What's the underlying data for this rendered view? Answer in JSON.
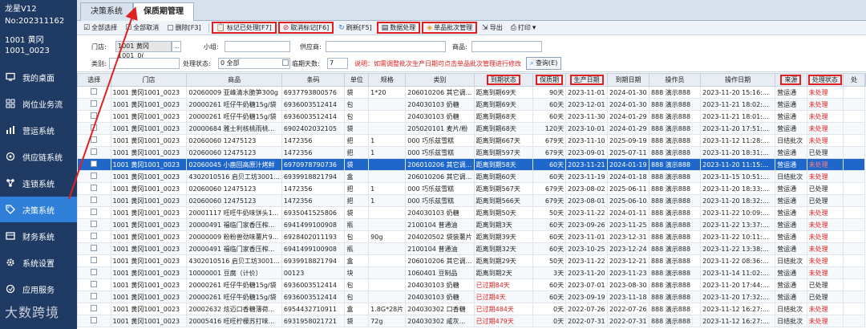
{
  "app": {
    "name": "龙星V12",
    "serial": "No:202311162",
    "store_line1": "1001 黄冈",
    "store_line2": "1001_0023"
  },
  "sidebar": {
    "items": [
      {
        "label": "我的桌面",
        "icon": "monitor-icon"
      },
      {
        "label": "岗位业务流",
        "icon": "workflow-icon"
      },
      {
        "label": "营运系统",
        "icon": "bar-chart-icon"
      },
      {
        "label": "供应链系统",
        "icon": "supply-chain-icon"
      },
      {
        "label": "连锁系统",
        "icon": "network-icon"
      },
      {
        "label": "决策系统",
        "icon": "tag-icon"
      },
      {
        "label": "财务系统",
        "icon": "finance-icon"
      },
      {
        "label": "系统设置",
        "icon": "gear-icon"
      },
      {
        "label": "应用服务",
        "icon": "service-icon"
      }
    ],
    "active_index": 5
  },
  "tabs": [
    {
      "label": "决策系统"
    },
    {
      "label": "保质期管理"
    }
  ],
  "toolbar": {
    "select_all": "全部选择",
    "deselect_all": "全部取消",
    "delete": "删除[F3]",
    "mark_processed": "标记已处理[F7]",
    "unmark": "取消标记[F6]",
    "refresh": "刷新[F5]",
    "data_process": "数据处理",
    "batch_manage": "单品批次管理",
    "export": "导出",
    "print": "打印"
  },
  "filters": {
    "store_label": "门店:",
    "store_value": "1001 黄冈1001_0(",
    "group_label": "小组:",
    "supplier_label": "供应商:",
    "product_label": "商品:",
    "category_label": "类别:",
    "status_label": "处理状态:",
    "status_value": "0 全部",
    "days_label": "临期天数:",
    "days_value": "7",
    "hint": "说明：如需调整批次生产日期可点击单品批次管理进行修改",
    "query": "查询(E)"
  },
  "grid": {
    "columns": [
      "选择",
      "门店",
      "商品",
      "条码",
      "单位",
      "规格",
      "类别",
      "到期状态",
      "保质期",
      "生产日期",
      "到期日期",
      "操作员",
      "操作日期",
      "来源",
      "处理状态",
      "处"
    ],
    "selected_row": 6,
    "rows": [
      [
        "",
        "1001 黄冈1001_0023",
        "02060009 亚峰清水脆笋300g",
        "6937793800576",
        "袋",
        "1*20",
        "206010206 其它调...",
        "距离到期69天",
        "90天",
        "2023-11-01",
        "2024-01-30",
        "888 演示888",
        "2023-11-20 15:16:...",
        "营运通",
        "未处理"
      ],
      [
        "",
        "1001 黄冈1001_0023",
        "20000261 旺仔牛奶糖15g/袋",
        "6936003512414",
        "包",
        "",
        "204030103 奶糖",
        "距离到期69天",
        "60天",
        "2023-12-01",
        "2024-01-30",
        "888 演示888",
        "2023-11-21 18:02:...",
        "营运通",
        "未处理"
      ],
      [
        "",
        "1001 黄冈1001_0023",
        "20000261 旺仔牛奶糖15g/袋",
        "6936003512414",
        "包",
        "",
        "204030103 奶糖",
        "距离到期68天",
        "60天",
        "2023-11-30",
        "2024-01-29",
        "888 演示888",
        "2023-11-21 18:01:...",
        "营运通",
        "未处理"
      ],
      [
        "",
        "1001 黄冈1001_0023",
        "20000684 雅士利核桃雨桃...",
        "6902402032105",
        "袋",
        "",
        "205020101 麦片/粉",
        "距离到期68天",
        "120天",
        "2023-10-01",
        "2024-01-29",
        "888 演示888",
        "2023-11-20 17:51:...",
        "营运通",
        "未处理"
      ],
      [
        "",
        "1001 黄冈1001_0023",
        "02060060 12475123",
        "1472356",
        "把",
        "1",
        "000 巧乐兹雪糕",
        "距离到期667天",
        "679天",
        "2023-11-10",
        "2025-09-19",
        "888 演示888",
        "2023-11-12 11:28:...",
        "日结批次",
        "未处理"
      ],
      [
        "",
        "1001 黄冈1001_0023",
        "02060060 12475123",
        "1472356",
        "把",
        "1",
        "000 巧乐兹雪糕",
        "距离到期597天",
        "679天",
        "2023-09-01",
        "2025-07-11",
        "888 演示888",
        "2023-11-20 18:31:...",
        "营运通",
        "已处理"
      ],
      [
        "",
        "1001 黄冈1001_0023",
        "02060045 小鹿回高原汁烤鲜",
        "6970978790736",
        "袋",
        "",
        "206010206 其它调...",
        "距离到期58天",
        "60天",
        "2023-11-21",
        "2024-01-19",
        "888 演示888",
        "2023-11-20 11:15:...",
        "营运通",
        "未处理"
      ],
      [
        "",
        "1001 黄冈1001_0023",
        "4302010516 启贝工坊3001...",
        "6939918821794",
        "盒",
        "",
        "206010206 其它调...",
        "距离到期60天",
        "60天",
        "2023-11-19",
        "2024-01-18",
        "888 演示888",
        "2023-11-15 10:51:...",
        "日结批次",
        "未处理"
      ],
      [
        "",
        "1001 黄冈1001_0023",
        "02060060 12475123",
        "1472356",
        "把",
        "1",
        "000 巧乐兹雪糕",
        "距离到期567天",
        "679天",
        "2023-08-02",
        "2025-06-11",
        "888 演示888",
        "2023-11-20 18:33:...",
        "营运通",
        "已处理"
      ],
      [
        "",
        "1001 黄冈1001_0023",
        "02060060 12475123",
        "1472356",
        "把",
        "1",
        "000 巧乐兹雪糕",
        "距离到期566天",
        "679天",
        "2023-08-01",
        "2025-06-10",
        "888 演示888",
        "2023-11-20 18:32:...",
        "营运通",
        "已处理"
      ],
      [
        "",
        "1001 黄冈1001_0023",
        "20001117 旺旺牛奶味饼头1...",
        "6935041525806",
        "袋",
        "",
        "204030103 奶糖",
        "距离到期50天",
        "50天",
        "2023-11-22",
        "2024-01-11",
        "888 演示888",
        "2023-11-22 10:09:...",
        "营运通",
        "未处理"
      ],
      [
        "",
        "1001 黄冈1001_0023",
        "20000491 福临门家香压榨...",
        "6941499100908",
        "瓶",
        "",
        "2100104 普通油",
        "距离到期3天",
        "60天",
        "2023-09-26",
        "2023-11-25",
        "888 演示888",
        "2023-11-22 13:37:...",
        "营运通",
        "未处理"
      ],
      [
        "",
        "1001 黄冈1001_0023",
        "20000009 粉粉兽劲味薯片9...",
        "6928402011193",
        "包",
        "90g",
        "204020502 袋装薯片",
        "距离到期39天",
        "60天",
        "2023-11-01",
        "2023-12-31",
        "888 演示888",
        "2023-11-22 10:11:...",
        "营运通",
        "未处理"
      ],
      [
        "",
        "1001 黄冈1001_0023",
        "20000491 福临门家香压榨...",
        "6941499100908",
        "瓶",
        "",
        "2100104 普通油",
        "距离到期32天",
        "60天",
        "2023-10-25",
        "2023-12-24",
        "888 演示888",
        "2023-11-22 13:38:...",
        "营运通",
        "未处理"
      ],
      [
        "",
        "1001 黄冈1001_0023",
        "4302010516 启贝工坊3001...",
        "6939918821794",
        "盒",
        "",
        "206010206 其它调...",
        "距离到期29天",
        "50天",
        "2023-11-22",
        "2023-12-21",
        "888 演示888",
        "2023-11-22 08:36:...",
        "日结批次",
        "未处理"
      ],
      [
        "",
        "1001 黄冈1001_0023",
        "10000001 豆腐（计价）",
        "00123",
        "块",
        "",
        "1060401 豆制品",
        "距离到期2天",
        "3天",
        "2023-11-20",
        "2023-11-23",
        "888 演示888",
        "2023-11-14 11:02:...",
        "营运通",
        "未处理"
      ],
      [
        "",
        "1001 黄冈1001_0023",
        "20000261 旺仔牛奶糖15g/袋",
        "6936003512414",
        "包",
        "",
        "204030103 奶糖",
        "已过期84天",
        "60天",
        "2023-07-01",
        "2023-08-30",
        "888 演示888",
        "2023-11-20 17:44:...",
        "营运通",
        "已处理"
      ],
      [
        "",
        "1001 黄冈1001_0023",
        "20000261 旺仔牛奶糖15g/袋",
        "6936003512414",
        "包",
        "",
        "204030103 奶糖",
        "已过期4天",
        "60天",
        "2023-09-19",
        "2023-11-18",
        "888 演示888",
        "2023-11-20 17:32:...",
        "营运通",
        "已处理"
      ],
      [
        "",
        "1001 黄冈1001_0023",
        "20002632 炫迈口香糖薄荷...",
        "6954432710911",
        "盒",
        "1.8G*28片",
        "204030302 口香糖",
        "已过期484天",
        "0天",
        "2022-07-26",
        "2022-07-26",
        "888 演示888",
        "2023-11-12 16:27:...",
        "日结批次",
        "未处理"
      ],
      [
        "",
        "1001 黄冈1001_0023",
        "20005416 旺旺柠檬苏打味...",
        "6931958021721",
        "袋",
        "72g",
        "204030302 咸灰...",
        "已过期479天",
        "0天",
        "2022-07-31",
        "2022-07-31",
        "888 演示888",
        "2023-11-12 16:27:...",
        "日结批次",
        "未处理"
      ]
    ]
  },
  "watermark": "大数跨境",
  "colors": {
    "sidebar_bg": "#1f3a63",
    "sidebar_active": "#2f7fd8",
    "selected_row": "#1f67c9",
    "highlight_red": "#e02020"
  }
}
